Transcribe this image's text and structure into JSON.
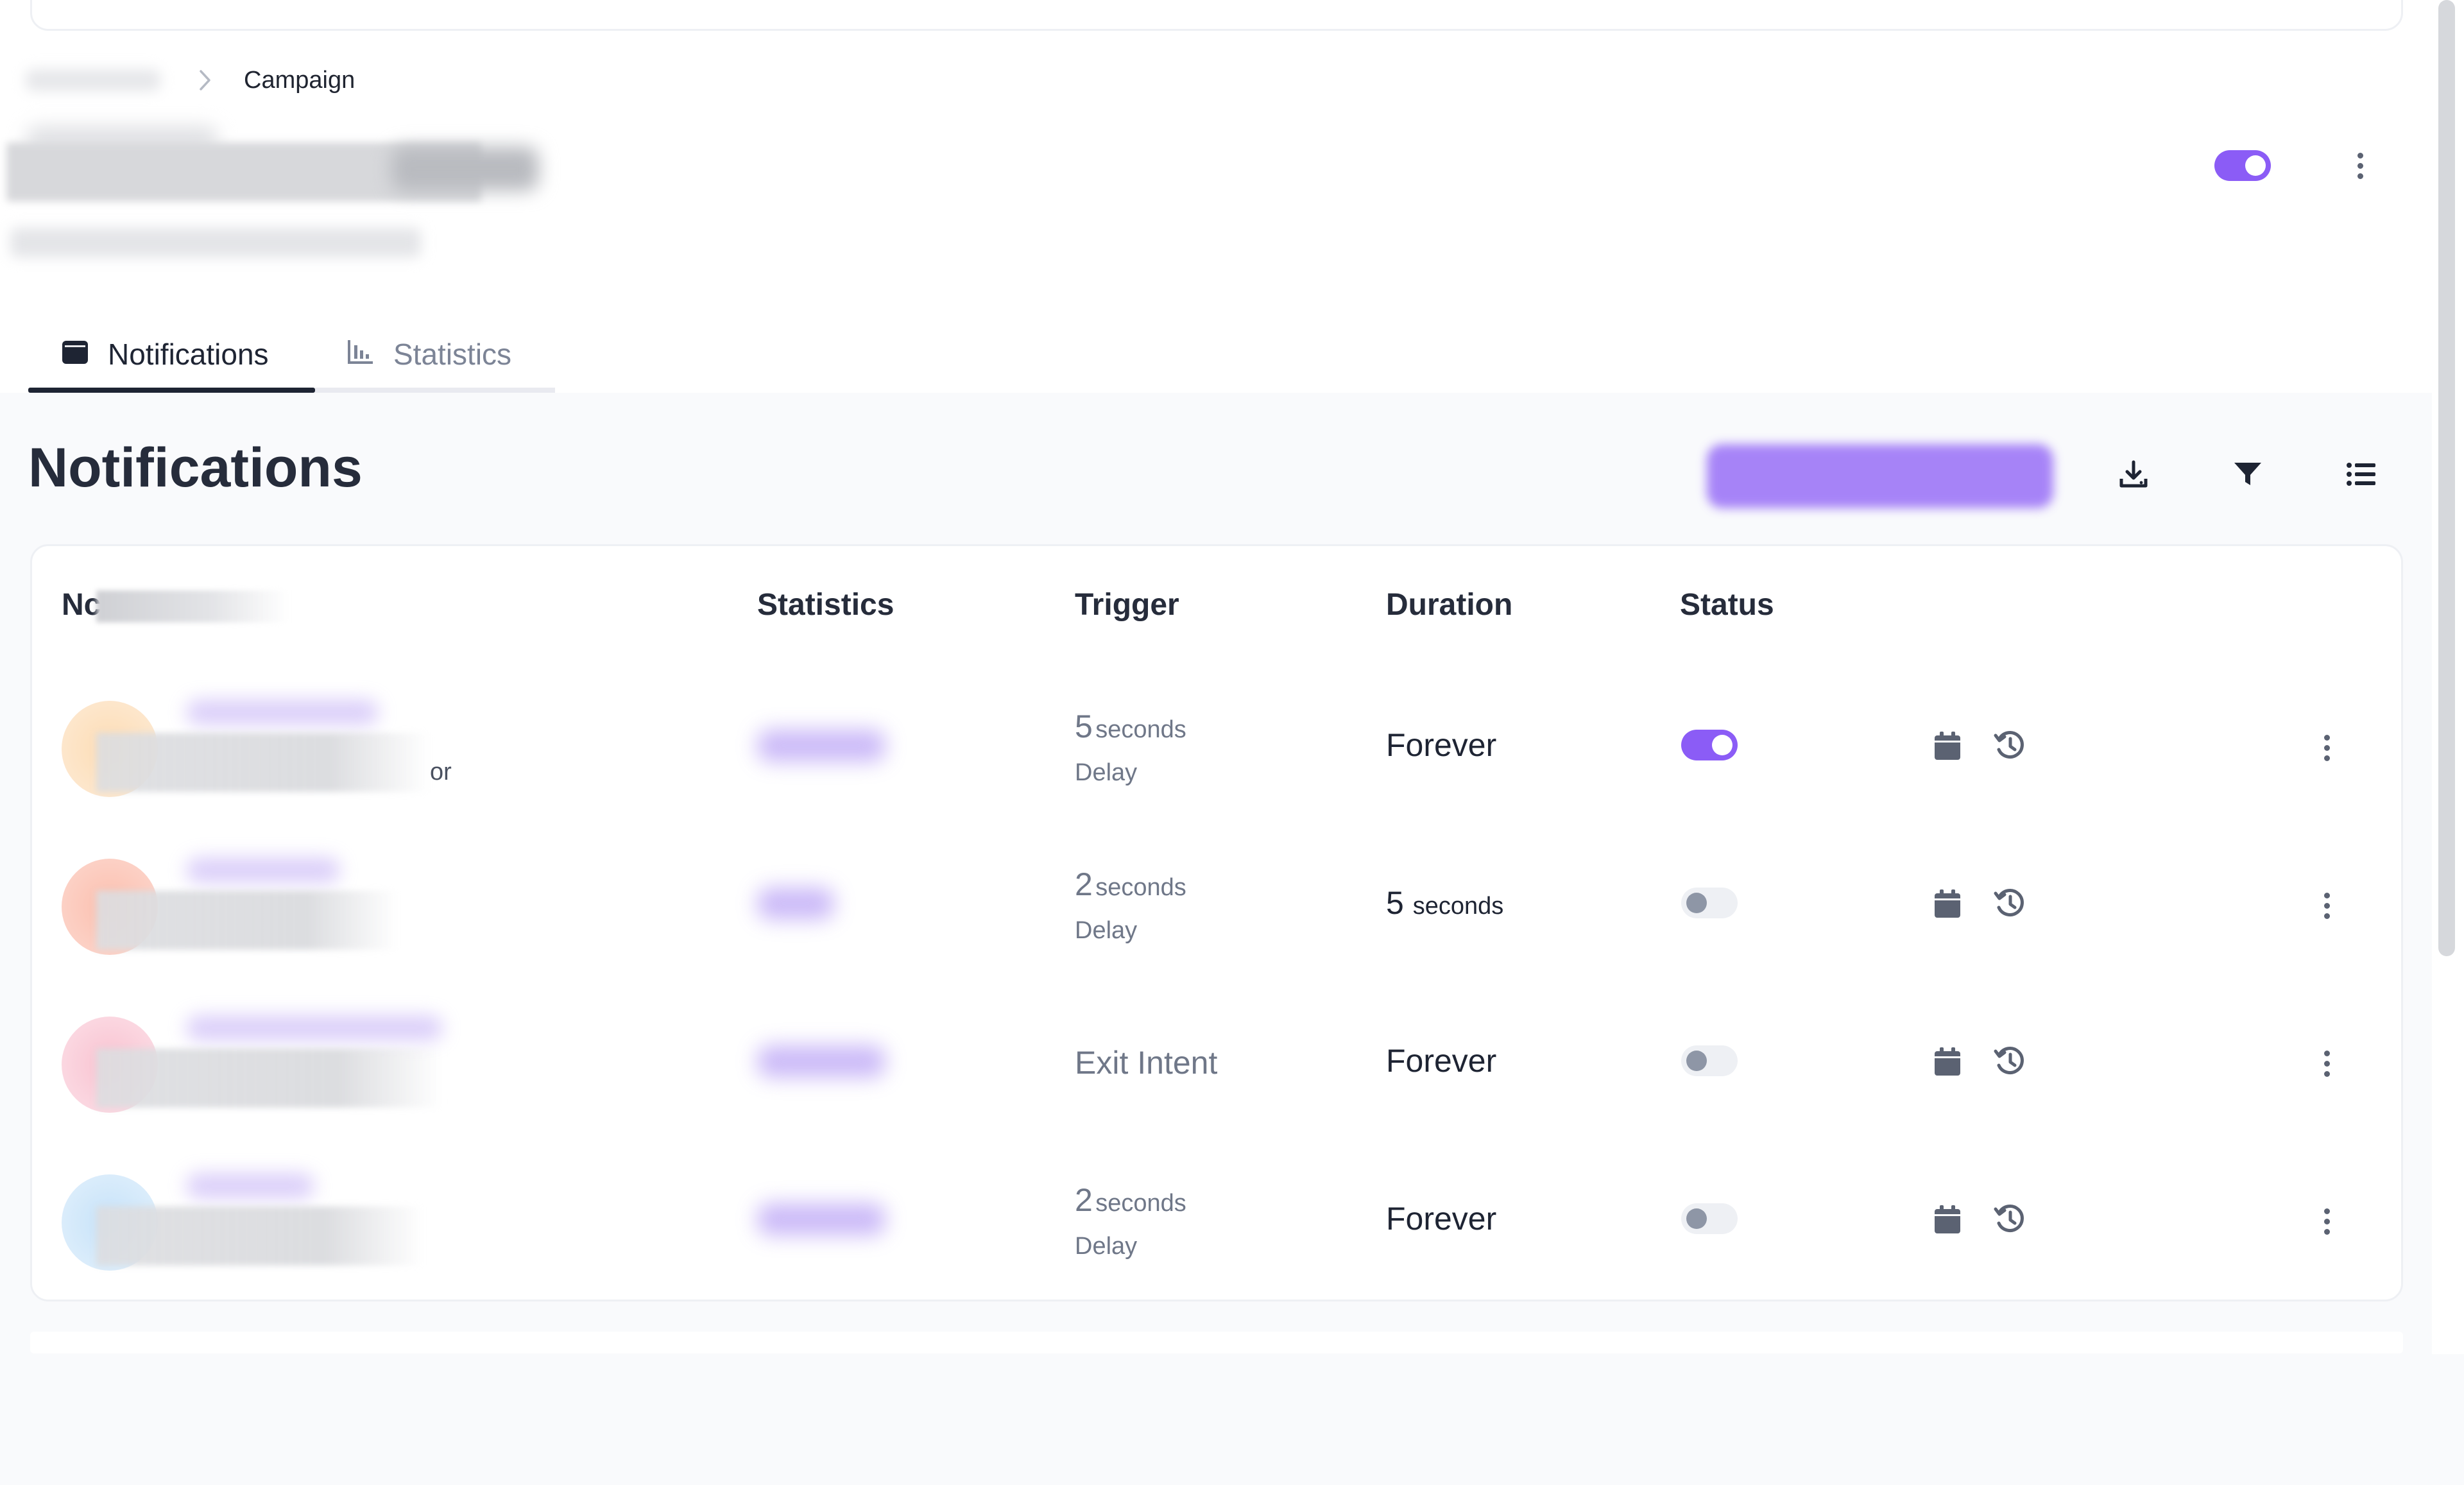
{
  "breadcrumb": {
    "current": "Campaign"
  },
  "campaign": {
    "enabled": true
  },
  "tabs": [
    {
      "label": "Notifications",
      "icon": "notification-card-icon",
      "active": true
    },
    {
      "label": "Statistics",
      "icon": "bar-chart-icon",
      "active": false
    }
  ],
  "section": {
    "title": "Notifications"
  },
  "toolbar": {
    "download_icon": "download-icon",
    "filter_icon": "filter-icon",
    "columns_icon": "list-icon"
  },
  "table": {
    "columns": {
      "name": "Nc",
      "statistics": "Statistics",
      "trigger": "Trigger",
      "duration": "Duration",
      "status": "Status"
    },
    "rows": [
      {
        "name_trailing_text": "or",
        "trigger_value": "5",
        "trigger_unit": "seconds",
        "trigger_sub": "Delay",
        "duration_value": "Forever",
        "duration_unit": "",
        "status_on": true,
        "avatar_color": "#fde5c6"
      },
      {
        "trigger_value": "2",
        "trigger_unit": "seconds",
        "trigger_sub": "Delay",
        "duration_value": "5",
        "duration_unit": "seconds",
        "status_on": false,
        "avatar_color": "#fcd1c6"
      },
      {
        "trigger_value": "Exit Intent",
        "duration_value": "Forever",
        "status_on": false,
        "avatar_color": "#fbd5de"
      },
      {
        "trigger_value": "2",
        "trigger_unit": "seconds",
        "trigger_sub": "Delay",
        "duration_value": "Forever",
        "duration_unit": "",
        "status_on": false,
        "avatar_color": "#d9ecfb"
      }
    ]
  },
  "colors": {
    "accent": "#8b5cf6",
    "text_primary": "#1e2433",
    "text_muted": "#6f7788",
    "page_bg": "#f9fafc"
  }
}
